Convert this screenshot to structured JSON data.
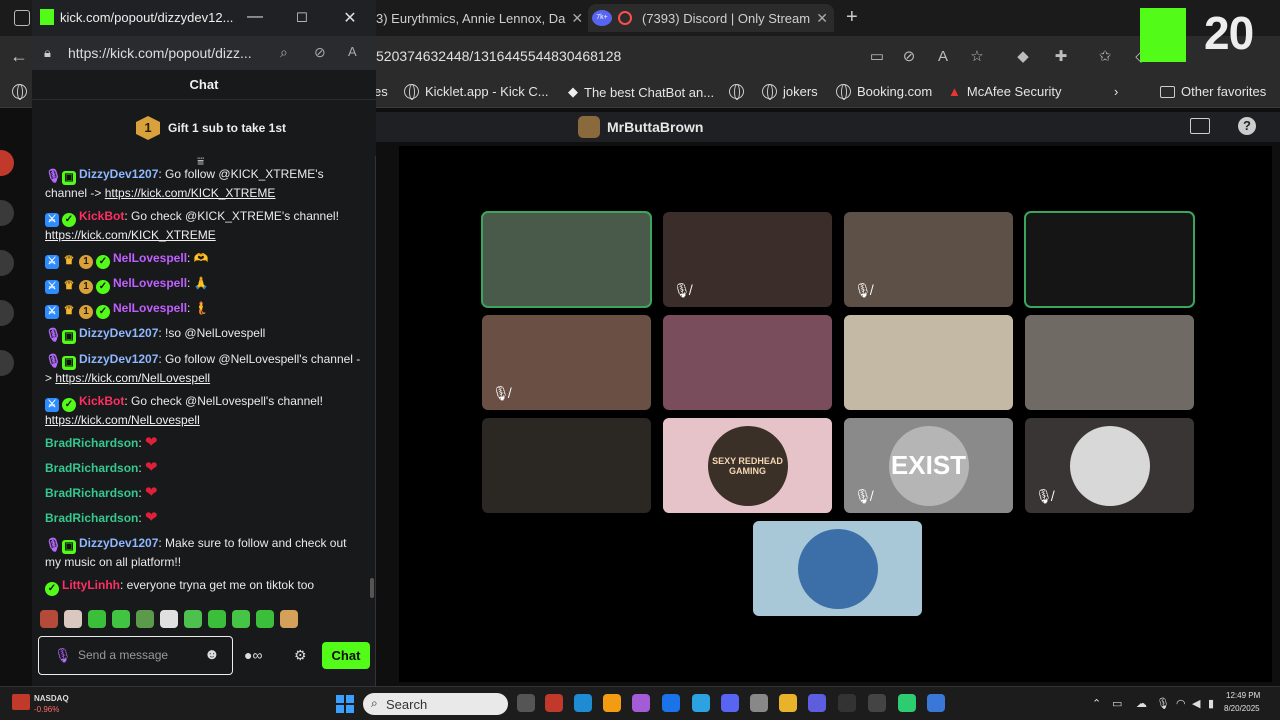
{
  "background_browser": {
    "tabs": [
      {
        "label": "3) Eurythmics, Annie Lennox, Da"
      },
      {
        "label": "(7393) Discord | Only Stream"
      }
    ],
    "tab_badge": "7k+",
    "url": "520374632448/1316445544830468128",
    "bookmarks": [
      "es",
      "Kicklet.app - Kick C...",
      "The best ChatBot an...",
      "jokers",
      "Booking.com",
      "McAfee Security"
    ],
    "other_favorites": "Other favorites"
  },
  "discord": {
    "channel_name": "MrButtaBrown",
    "participants": [
      {
        "speaking": true,
        "muted": false,
        "color": "#4a5a4a"
      },
      {
        "speaking": false,
        "muted": true,
        "color": "#3b2e2a"
      },
      {
        "speaking": false,
        "muted": true,
        "color": "#5d5046"
      },
      {
        "speaking": true,
        "muted": false,
        "color": "#151515"
      },
      {
        "speaking": false,
        "muted": true,
        "color": "#6a4f45"
      },
      {
        "speaking": false,
        "muted": false,
        "color": "#7a4d5c"
      },
      {
        "speaking": false,
        "muted": false,
        "color": "#c3b9a4"
      },
      {
        "speaking": false,
        "muted": false,
        "color": "#6f6a64"
      },
      {
        "speaking": false,
        "muted": false,
        "color": "#2b2723"
      },
      {
        "speaking": false,
        "muted": false,
        "color": "#e6c3c8",
        "text": "SEXY REDHEAD GAMING"
      },
      {
        "speaking": false,
        "muted": true,
        "color": "#8a8a8a",
        "text": "EXIST"
      },
      {
        "speaking": false,
        "muted": true,
        "color": "#3a3535"
      },
      {
        "speaking": false,
        "muted": false,
        "color": "#a8c8d8"
      }
    ]
  },
  "overlay": {
    "kick_number": "20"
  },
  "popout": {
    "window_title": "kick.com/popout/dizzydev12...",
    "url": "https://kick.com/popout/dizz...",
    "chat_title": "Chat",
    "gift_badge": "1",
    "gift_text": "Gift 1 sub to take 1st",
    "messages": [
      {
        "user": "DizzyDev1207",
        "cls": "u-dizzy",
        "badges": [
          "mic",
          "gift"
        ],
        "text": ": Go follow @KICK_XTREME's channel -> ",
        "link": "https://kick.com/KICK_XTREME"
      },
      {
        "user": "KickBot",
        "cls": "u-kick",
        "badges": [
          "mod",
          "ver"
        ],
        "text": ": Go check @KICK_XTREME's channel! ",
        "link": "https://kick.com/KICK_XTREME"
      },
      {
        "user": "NelLovespell",
        "cls": "u-nel",
        "badges": [
          "mod",
          "crown",
          "one",
          "ver"
        ],
        "text": ": ",
        "emote": "🫶"
      },
      {
        "user": "NelLovespell",
        "cls": "u-nel",
        "badges": [
          "mod",
          "crown",
          "one",
          "ver"
        ],
        "text": ": ",
        "emote": "🙏"
      },
      {
        "user": "NelLovespell",
        "cls": "u-nel",
        "badges": [
          "mod",
          "crown",
          "one",
          "ver"
        ],
        "text": ": ",
        "emote": "🧜"
      },
      {
        "user": "DizzyDev1207",
        "cls": "u-dizzy",
        "badges": [
          "mic",
          "gift"
        ],
        "text": ": !so @NelLovespell"
      },
      {
        "user": "DizzyDev1207",
        "cls": "u-dizzy",
        "badges": [
          "mic",
          "gift"
        ],
        "text": ": Go follow @NelLovespell's channel -> ",
        "link": "https://kick.com/NelLovespell"
      },
      {
        "user": "KickBot",
        "cls": "u-kick",
        "badges": [
          "mod",
          "ver"
        ],
        "text": ": Go check @NelLovespell's channel! ",
        "link": "https://kick.com/NelLovespell"
      },
      {
        "user": "BradRichardson",
        "cls": "u-brad",
        "badges": [],
        "text": ": ",
        "emote": "❤"
      },
      {
        "user": "BradRichardson",
        "cls": "u-brad",
        "badges": [],
        "text": ": ",
        "emote": "❤"
      },
      {
        "user": "BradRichardson",
        "cls": "u-brad",
        "badges": [],
        "text": ": ",
        "emote": "❤"
      },
      {
        "user": "BradRichardson",
        "cls": "u-brad",
        "badges": [],
        "text": ": ",
        "emote": "❤"
      },
      {
        "user": "DizzyDev1207",
        "cls": "u-dizzy",
        "badges": [
          "mic",
          "gift"
        ],
        "text": ": Make sure to follow and check out my music on all platform!!"
      },
      {
        "user": "LittyLinhh",
        "cls": "u-litty",
        "badges": [
          "ver"
        ],
        "text": ": everyone tryna get me on tiktok too"
      }
    ],
    "input_placeholder": "Send a message",
    "send_label": "Chat"
  },
  "taskbar": {
    "nasdaq_label": "NASDAQ",
    "nasdaq_change": "-0.96%",
    "search_label": "Search",
    "time": "12:49 PM",
    "date": "8/20/2025"
  }
}
